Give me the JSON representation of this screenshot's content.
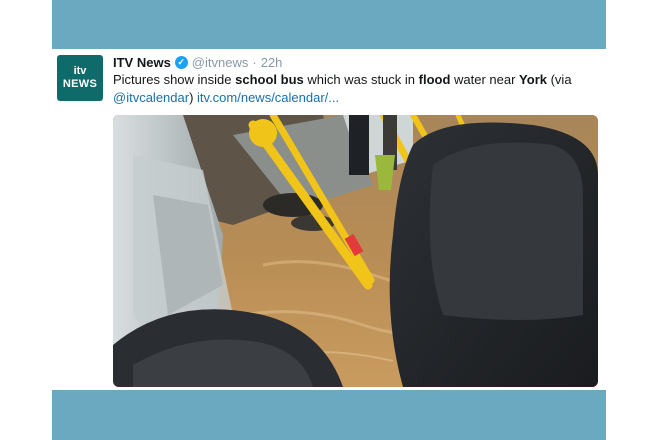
{
  "tweet": {
    "avatar": {
      "line1": "itv",
      "line2": "NEWS"
    },
    "name": "ITV News",
    "verified_icon": "verified-badge-icon",
    "handle": "@itvnews",
    "separator": "·",
    "time": "22h",
    "text": {
      "t1": "Pictures show inside ",
      "b1": "school bus",
      "t2": " which was stuck in ",
      "b2": "flood",
      "t3": " water near ",
      "b3": "York",
      "t4": " (via",
      "mention": "@itvcalendar",
      "t5": ") ",
      "url": "itv.com/news/calendar/..."
    },
    "photo": "flooded-school-bus-interior-photo"
  },
  "colors": {
    "band": "#6aa9bf",
    "avatar_bg": "#0f6b6a",
    "link": "#1b6fa8",
    "verified": "#1da1f2"
  }
}
